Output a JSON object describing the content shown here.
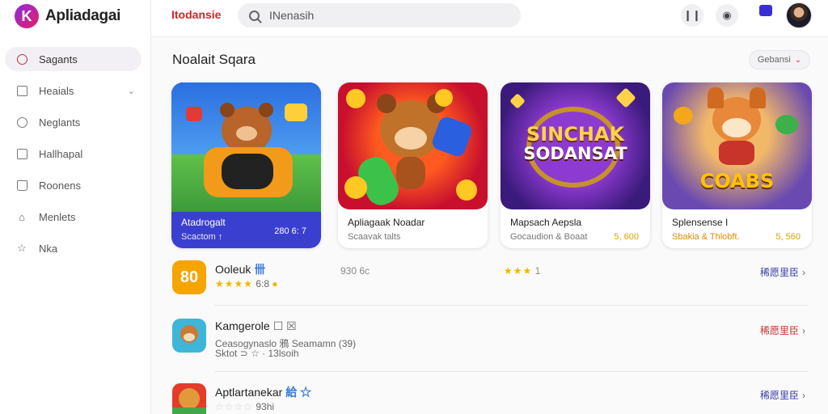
{
  "app": {
    "logo_letter": "K",
    "name": "Apliadagai"
  },
  "sidebar": {
    "items": [
      {
        "label": "Sagants",
        "icon": "search-icon"
      },
      {
        "label": "Heaials",
        "icon": "square-icon"
      },
      {
        "label": "Neglants",
        "icon": "circle-icon"
      },
      {
        "label": "Hallhapal",
        "icon": "grid-icon"
      },
      {
        "label": "Roonens",
        "icon": "bag-icon"
      },
      {
        "label": "Menlets",
        "icon": "home-icon"
      },
      {
        "label": "Nka",
        "icon": "star-icon"
      }
    ]
  },
  "topbar": {
    "title": "Itodansie",
    "search_value": "INenasih",
    "icon1": "❙❙",
    "icon2": "◉"
  },
  "section": {
    "title": "Noalait Sqara",
    "button_label": "Gebansi"
  },
  "cards": [
    {
      "title": "Atadrogalt",
      "sub": "Scactom",
      "sub_mark": "↑",
      "rating": "280 6: 7"
    },
    {
      "title": "Apliagaak Noadar",
      "sub": "Scaavak talts",
      "rating": ""
    },
    {
      "title": "Mapsach Aepsla",
      "sub": "Gocaudion & Boaat",
      "rating": "5, 600",
      "banner_top": "SINCHAK",
      "banner_bottom": "SODANSAT"
    },
    {
      "title": "Splensense I",
      "sub": "Sbakia & Thlobft.",
      "rating": "5, 560",
      "banner": "COABS"
    }
  ],
  "list": [
    {
      "title": "Ooleuk",
      "badge": "卌",
      "rating_text": "6:8",
      "mid_text": "930 6c",
      "mid_stars": "★★★",
      "mid_count": "1",
      "action": "稀愿里臣",
      "action_color": "#3a3aa8",
      "icon_text": "80"
    },
    {
      "title": "Kamgerole",
      "badge": "☐ ☒",
      "sub1": "Ceasogynaslo 鴉 Seamamn (39)",
      "sub2": "Sktot ⊃ ☆ ·",
      "sub2_b": "13lsoih",
      "action": "稀愿里臣",
      "action_color": "#c83030"
    },
    {
      "title": "Aptlartanekar",
      "badge": "給 ☆",
      "sub2": "☆☆☆☆",
      "sub2_b": "93hi",
      "action": "稀愿里臣",
      "action_color": "#3a3aa8"
    }
  ]
}
